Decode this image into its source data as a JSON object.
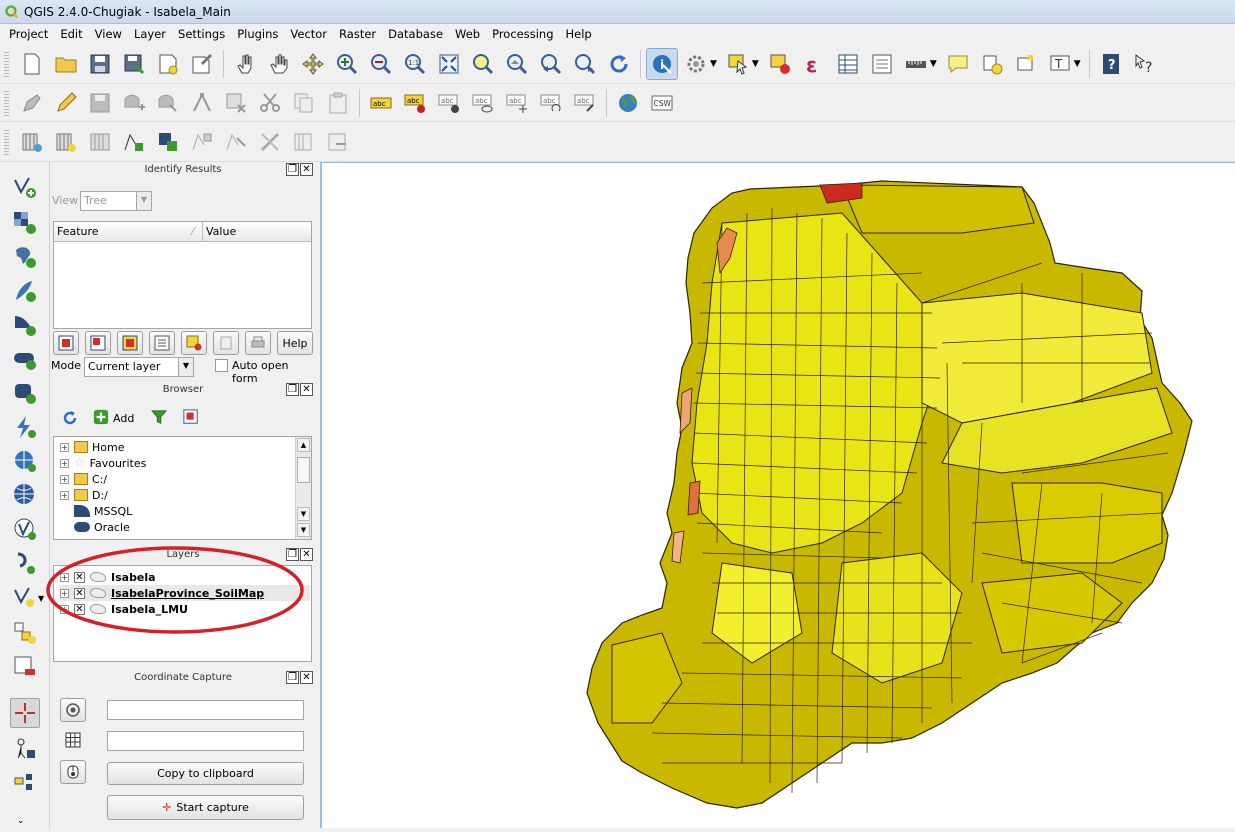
{
  "window": {
    "title": "QGIS 2.4.0-Chugiak - Isabela_Main"
  },
  "menu": [
    "Project",
    "Edit",
    "View",
    "Layer",
    "Settings",
    "Plugins",
    "Vector",
    "Raster",
    "Database",
    "Web",
    "Processing",
    "Help"
  ],
  "colors": {
    "accent": "#3a74b7",
    "map_fill_dark": "#c9b800",
    "map_fill_light": "#eef000",
    "map_fill_orange": "#e8894e",
    "map_fill_red": "#cc2a1a",
    "circle": "#d81f26"
  },
  "identify": {
    "title": "Identify Results",
    "view_label": "View",
    "view_value": "Tree",
    "col_feature": "Feature",
    "col_value": "Value",
    "help_label": "Help",
    "mode_label": "Mode",
    "mode_value": "Current layer",
    "auto_open_label": "Auto open form"
  },
  "browser": {
    "title": "Browser",
    "add_label": "Add",
    "items": [
      "Home",
      "Favourites",
      "C:/",
      "D:/",
      "MSSQL",
      "Oracle"
    ]
  },
  "layers": {
    "title": "Layers",
    "items": [
      "Isabela",
      "IsabelaProvince_SoilMap",
      "Isabela_LMU"
    ]
  },
  "coord": {
    "title": "Coordinate Capture",
    "copy_label": "Copy to clipboard",
    "start_label": "Start capture"
  }
}
